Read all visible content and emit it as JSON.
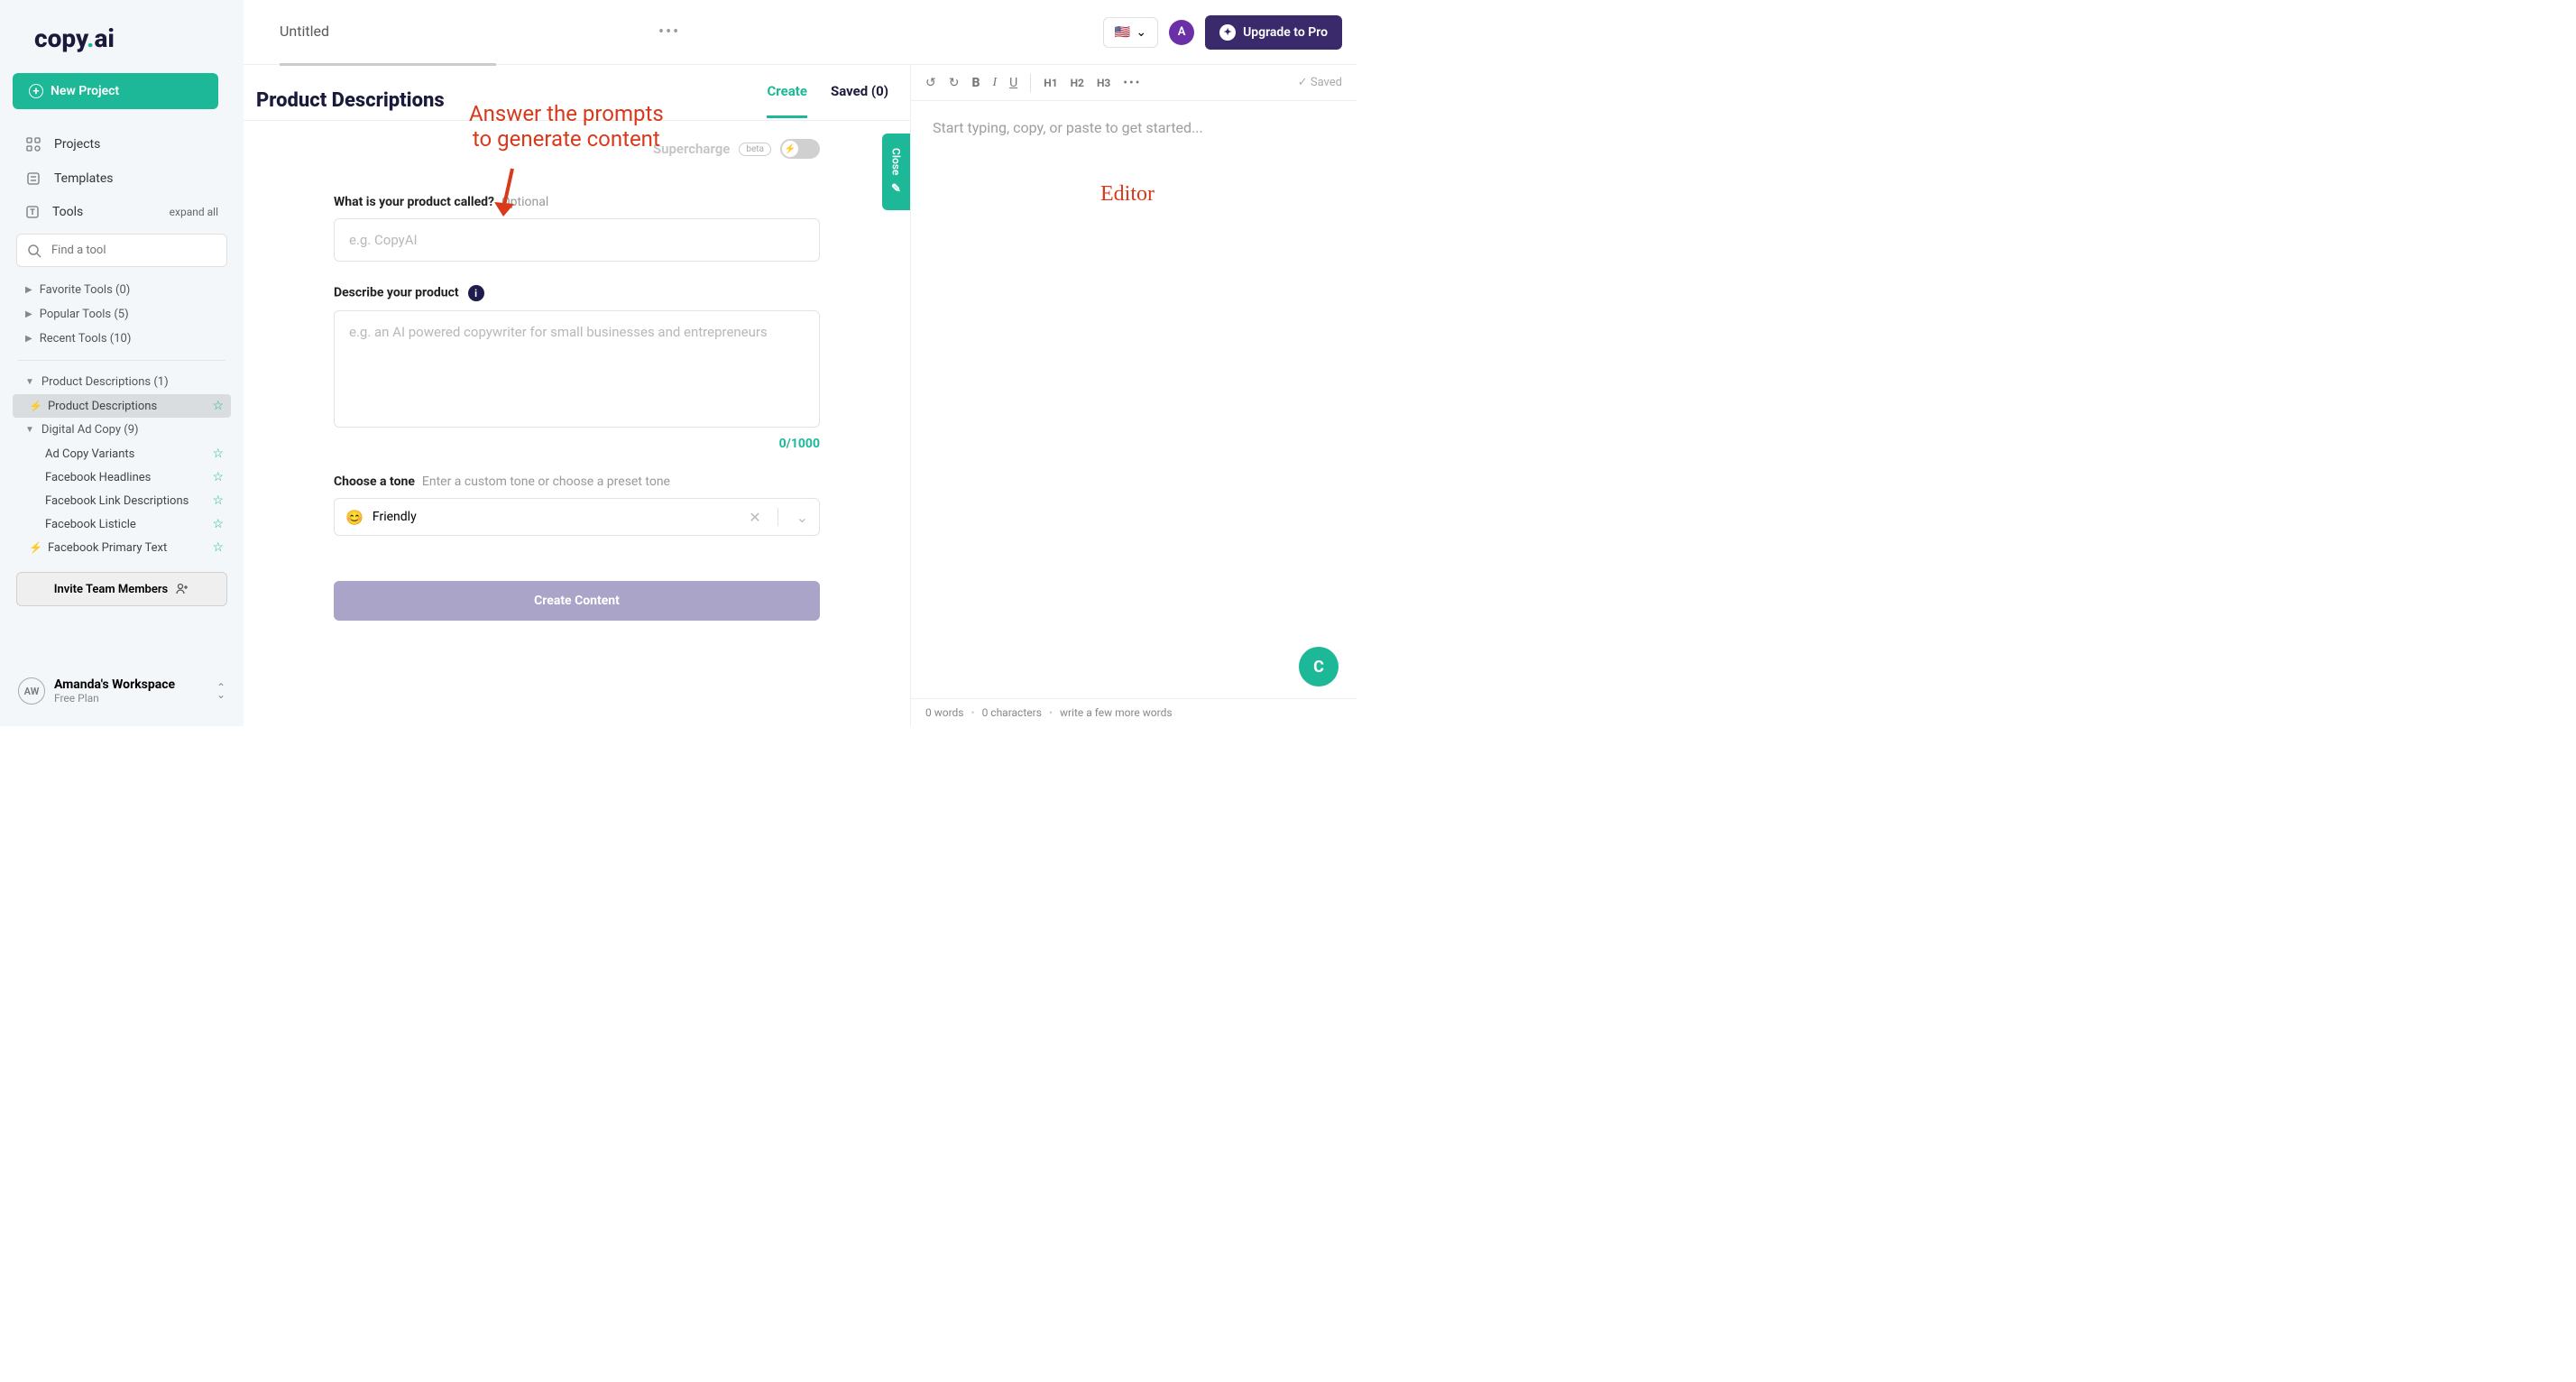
{
  "logo": {
    "brand": "copy",
    "dot": ".",
    "suffix": "ai"
  },
  "sidebar": {
    "new_project": "New Project",
    "projects": "Projects",
    "templates": "Templates",
    "tools": "Tools",
    "expand_all": "expand all",
    "search_placeholder": "Find a tool",
    "favorite_tools": "Favorite Tools (0)",
    "popular_tools": "Popular Tools (5)",
    "recent_tools": "Recent Tools (10)",
    "product_desc_group": "Product Descriptions (1)",
    "product_desc_item": "Product Descriptions",
    "digital_ad_group": "Digital Ad Copy (9)",
    "tools_list": [
      {
        "label": "Ad Copy Variants"
      },
      {
        "label": "Facebook Headlines"
      },
      {
        "label": "Facebook Link Descriptions"
      },
      {
        "label": "Facebook Listicle"
      },
      {
        "label": "Facebook Primary Text"
      }
    ],
    "invite": "Invite Team Members",
    "workspace_initials": "AW",
    "workspace_name": "Amanda's Workspace",
    "workspace_plan": "Free Plan"
  },
  "topbar": {
    "tab_title": "Untitled",
    "flag": "🇺🇸",
    "avatar": "A",
    "upgrade": "Upgrade to Pro"
  },
  "create": {
    "heading": "Product Descriptions",
    "tab_create": "Create",
    "tab_saved": "Saved (0)",
    "supercharge": "Supercharge",
    "beta": "beta",
    "q1": "What is your product called?",
    "q1_optional": "Optional",
    "q1_placeholder": "e.g. CopyAI",
    "q2": "Describe your product",
    "q2_placeholder": "e.g. an AI powered copywriter for small businesses and entrepreneurs",
    "charcount": "0/1000",
    "q3": "Choose a tone",
    "q3_hint": "Enter a custom tone or choose a preset tone",
    "tone_emoji": "😊",
    "tone_value": "Friendly",
    "create_btn": "Create Content",
    "close_label": "Close"
  },
  "annotations": {
    "prompt_l1": "Answer the prompts",
    "prompt_l2": "to generate content",
    "editor": "Editor"
  },
  "editor": {
    "saved": "Saved",
    "placeholder": "Start typing, copy, or paste to get started...",
    "words": "0 words",
    "chars": "0 characters",
    "hint": "write a few more words",
    "fab": "C",
    "h1": "H1",
    "h2": "H2",
    "h3": "H3"
  }
}
